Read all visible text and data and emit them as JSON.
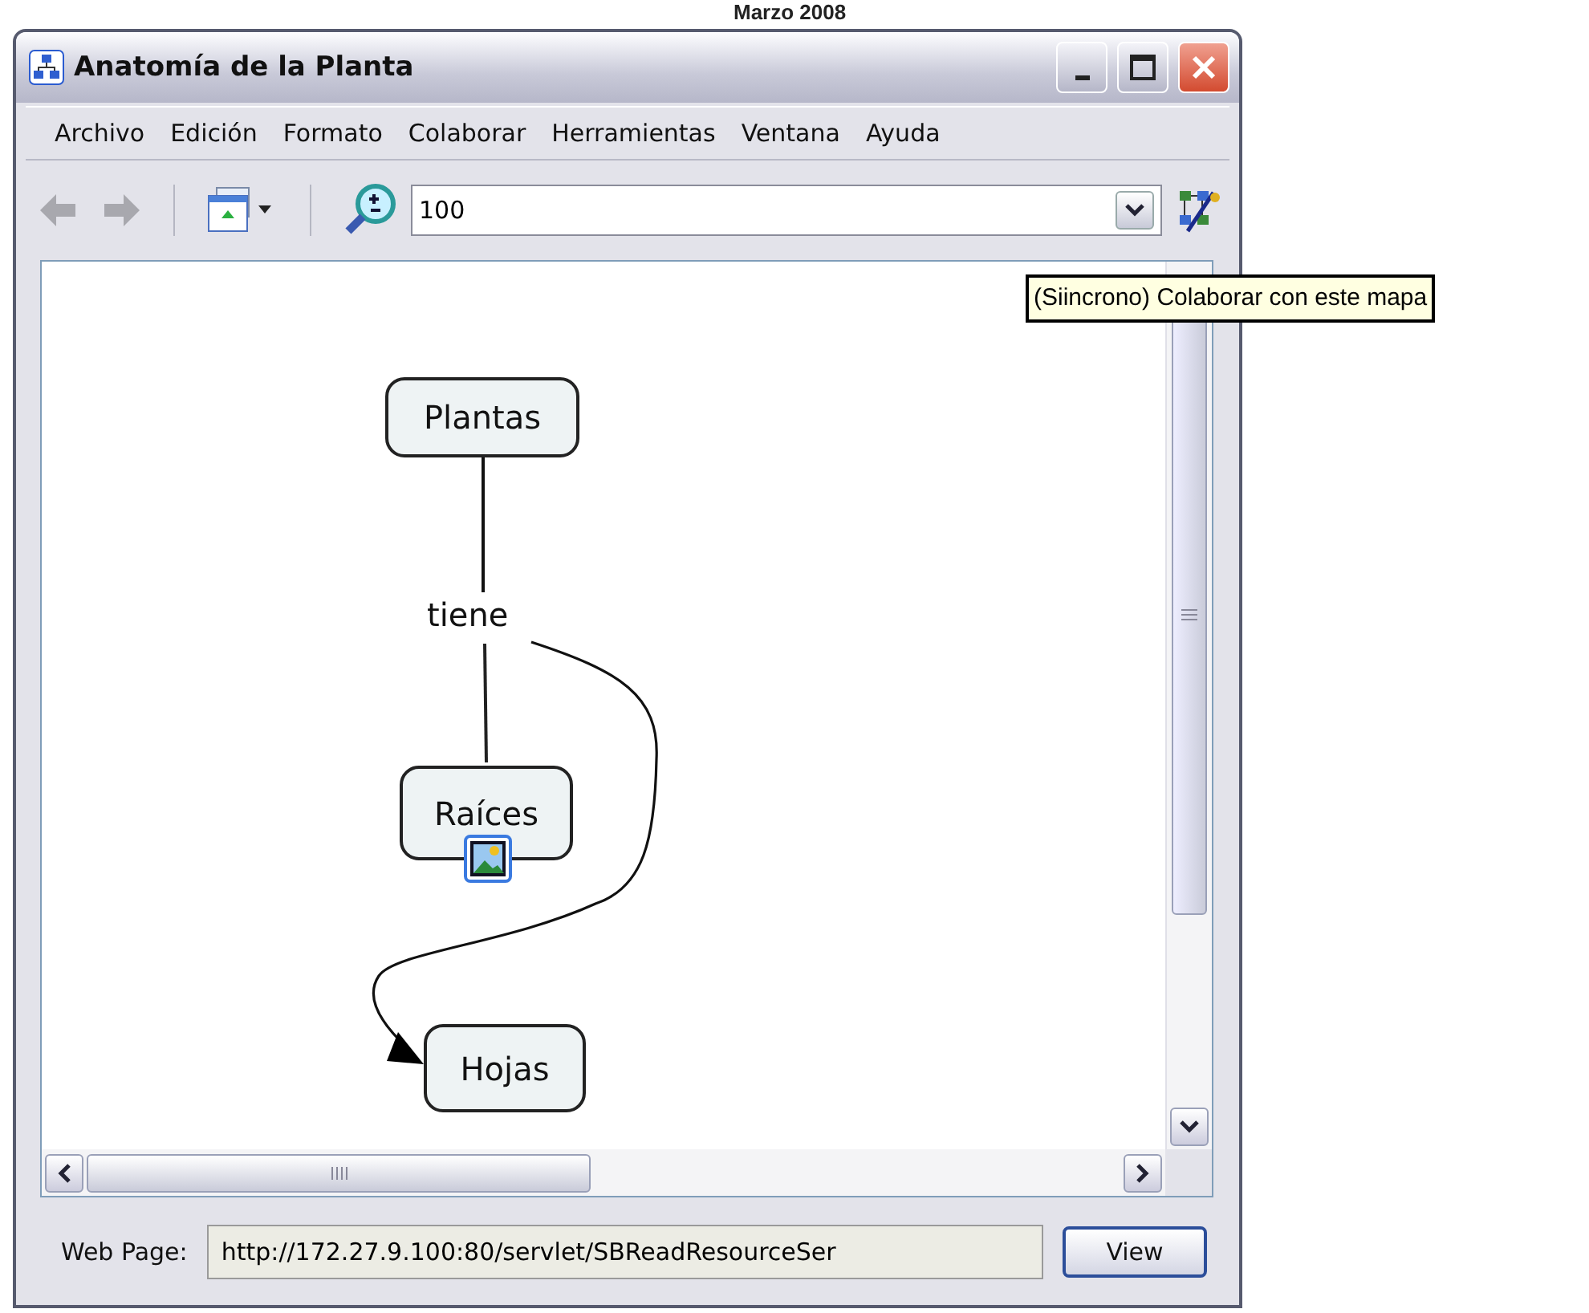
{
  "caption": "Marzo 2008",
  "window": {
    "title": "Anatomía de la Planta"
  },
  "menu": [
    "Archivo",
    "Edición",
    "Formato",
    "Colaborar",
    "Herramientas",
    "Ventana",
    "Ayuda"
  ],
  "toolbar": {
    "zoom_value": "100"
  },
  "tooltip": "(Siincrono) Colaborar con este mapa",
  "concept_map": {
    "concepts": [
      {
        "label": "Plantas",
        "has_image_resource": false
      },
      {
        "label": "Raíces",
        "has_image_resource": true
      },
      {
        "label": "Hojas",
        "has_image_resource": false
      }
    ],
    "linking_phrase": "tiene"
  },
  "web_page": {
    "label": "Web Page:",
    "value": "http://172.27.9.100:80/servlet/SBReadResourceSer",
    "button": "View"
  }
}
